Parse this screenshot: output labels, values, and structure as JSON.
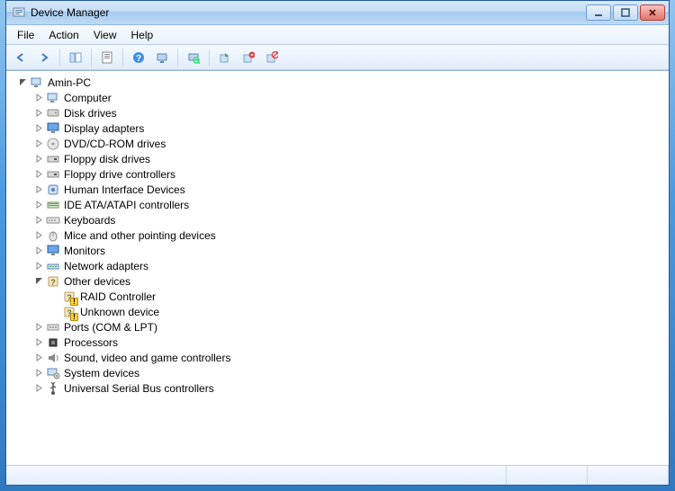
{
  "window": {
    "title": "Device Manager"
  },
  "menu": {
    "file": "File",
    "action": "Action",
    "view": "View",
    "help": "Help"
  },
  "toolbar": {
    "back": "back-icon",
    "forward": "forward-icon",
    "show_hide_tree": "tree-pane-icon",
    "properties": "properties-icon",
    "help": "help-icon",
    "action_center": "monitor-action-icon",
    "scan": "scan-hardware-icon",
    "update": "update-driver-icon",
    "uninstall": "uninstall-icon",
    "disable": "disable-icon"
  },
  "tree": {
    "root": {
      "label": "Amin-PC",
      "icon": "computer-root-icon",
      "expanded": true,
      "children": [
        {
          "label": "Computer",
          "icon": "computer-icon"
        },
        {
          "label": "Disk drives",
          "icon": "disk-icon"
        },
        {
          "label": "Display adapters",
          "icon": "display-icon"
        },
        {
          "label": "DVD/CD-ROM drives",
          "icon": "optical-icon"
        },
        {
          "label": "Floppy disk drives",
          "icon": "floppy-icon"
        },
        {
          "label": "Floppy drive controllers",
          "icon": "floppy-controller-icon"
        },
        {
          "label": "Human Interface Devices",
          "icon": "hid-icon"
        },
        {
          "label": "IDE ATA/ATAPI controllers",
          "icon": "ide-icon"
        },
        {
          "label": "Keyboards",
          "icon": "keyboard-icon"
        },
        {
          "label": "Mice and other pointing devices",
          "icon": "mouse-icon"
        },
        {
          "label": "Monitors",
          "icon": "monitor-icon"
        },
        {
          "label": "Network adapters",
          "icon": "network-icon"
        },
        {
          "label": "Other devices",
          "icon": "other-icon",
          "expanded": true,
          "children": [
            {
              "label": "RAID Controller",
              "icon": "unknown-device-icon",
              "warning": true,
              "leaf": true
            },
            {
              "label": "Unknown device",
              "icon": "unknown-device-icon",
              "warning": true,
              "leaf": true
            }
          ]
        },
        {
          "label": "Ports (COM & LPT)",
          "icon": "ports-icon"
        },
        {
          "label": "Processors",
          "icon": "cpu-icon"
        },
        {
          "label": "Sound, video and game controllers",
          "icon": "sound-icon"
        },
        {
          "label": "System devices",
          "icon": "system-icon"
        },
        {
          "label": "Universal Serial Bus controllers",
          "icon": "usb-icon"
        }
      ]
    }
  }
}
